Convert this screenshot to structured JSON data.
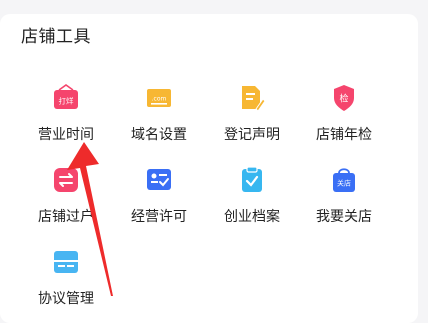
{
  "section": {
    "title": "店铺工具"
  },
  "tools": [
    {
      "label": "营业时间",
      "icon": "open-hours-icon",
      "color": "#f5456d",
      "badge": "打烊"
    },
    {
      "label": "域名设置",
      "icon": "domain-icon",
      "color": "#f7b733",
      "badge": ".com"
    },
    {
      "label": "登记声明",
      "icon": "registration-document-icon",
      "color": "#f7b733"
    },
    {
      "label": "店铺年检",
      "icon": "annual-inspection-shield-icon",
      "color": "#f5456d",
      "badge": "检"
    },
    {
      "label": "店铺过户",
      "icon": "transfer-icon",
      "color": "#f5456d"
    },
    {
      "label": "经营许可",
      "icon": "license-id-card-icon",
      "color": "#3a6ff5"
    },
    {
      "label": "创业档案",
      "icon": "archive-clipboard-icon",
      "color": "#37b7f0"
    },
    {
      "label": "我要关店",
      "icon": "close-store-bag-icon",
      "color": "#3a6ff5",
      "badge": "关店"
    },
    {
      "label": "协议管理",
      "icon": "agreement-card-icon",
      "color": "#48b5f2"
    }
  ],
  "annotation": {
    "icon": "red-arrow-icon",
    "color": "#ee2b2b"
  }
}
